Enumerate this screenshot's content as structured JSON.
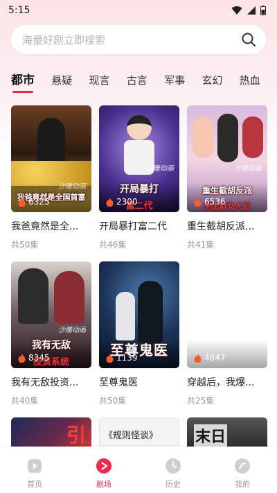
{
  "status_bar": {
    "time": "5:15"
  },
  "search": {
    "placeholder": "海量好剧立即搜索"
  },
  "tabs": [
    {
      "label": "都市",
      "active": true
    },
    {
      "label": "悬疑"
    },
    {
      "label": "现言"
    },
    {
      "label": "古言"
    },
    {
      "label": "军事"
    },
    {
      "label": "玄幻"
    },
    {
      "label": "热血"
    }
  ],
  "dramas": [
    {
      "title": "我爸竟然是全...",
      "episodes": "共50集",
      "heat": "6325",
      "overlay": "我爸竟然是全国首富",
      "brand": "沙雕动画",
      "colors": [
        "#7a4b2a",
        "#c69a3f"
      ]
    },
    {
      "title": "开局暴打富二代",
      "episodes": "共46集",
      "heat": "2300",
      "overlay": "开局暴打",
      "overlay2": "富二代",
      "brand": "沙雕动画",
      "colors": [
        "#3b2a6e",
        "#9b6fd6"
      ]
    },
    {
      "title": "重生截胡反派...",
      "episodes": "共41集",
      "heat": "6536",
      "overlay": "重生截胡反派",
      "overlay2": "男主财女人们",
      "brand": "沙雕动画",
      "colors": [
        "#c9a7d6",
        "#f2d2e0"
      ]
    },
    {
      "title": "我有无敌投资...",
      "episodes": "共40集",
      "heat": "8345",
      "overlay": "我有无敌",
      "overlay2": "投资系统",
      "brand": "沙雕动画",
      "colors": [
        "#3a3236",
        "#7a2430"
      ]
    },
    {
      "title": "至尊鬼医",
      "episodes": "共50集",
      "heat": "1139",
      "overlay": "至尊鬼医",
      "brand": "",
      "colors": [
        "#0f1e3a",
        "#3c5f8a"
      ]
    },
    {
      "title": "穿越后，我爆...",
      "episodes": "共25集",
      "heat": "4847",
      "overlay": "",
      "brand": "",
      "colors": [
        "#ffffff",
        "#ffffff"
      ]
    }
  ],
  "peek_cards": [
    {
      "text": "引",
      "colors": [
        "#1c2a5a",
        "#c73a3a"
      ]
    },
    {
      "text": "《规则怪谈》",
      "colors": [
        "#f4f4f4",
        "#e0e0e0"
      ]
    },
    {
      "text": "末日",
      "colors": [
        "#2b2b2b",
        "#555555"
      ]
    }
  ],
  "bottom_nav": [
    {
      "label": "首页",
      "icon": "home-play-icon"
    },
    {
      "label": "剧场",
      "icon": "theater-play-icon",
      "active": true
    },
    {
      "label": "历史",
      "icon": "history-clock-icon"
    },
    {
      "label": "我的",
      "icon": "profile-icon"
    }
  ],
  "accent_color": "#ee2a4f"
}
